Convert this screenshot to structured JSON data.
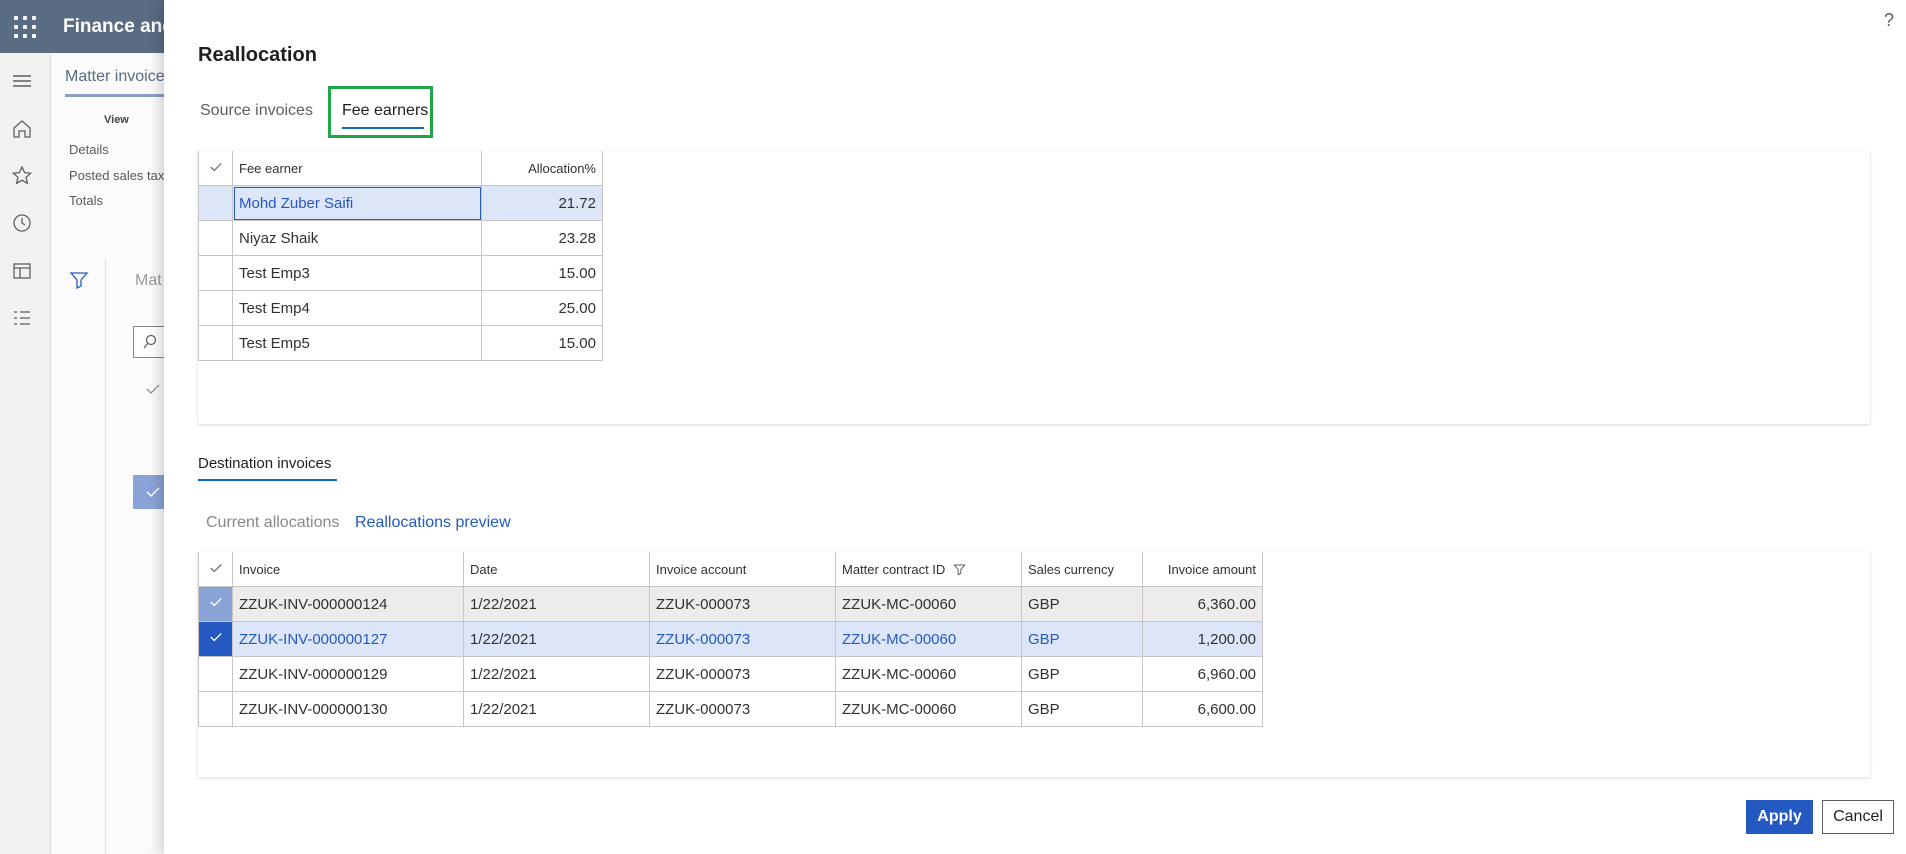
{
  "app": {
    "title": "Finance and",
    "page_tab": "Matter invoice",
    "view_label": "View",
    "menu": [
      "Details",
      "Posted sales tax",
      "Totals"
    ],
    "list_title": "Mat"
  },
  "dialog": {
    "title": "Reallocation",
    "help": "?",
    "tabs": {
      "source": "Source invoices",
      "fee_earners": "Fee earners"
    },
    "fee_grid": {
      "headers": {
        "fee_earner": "Fee earner",
        "allocation": "Allocation%"
      },
      "rows": [
        {
          "name": "Mohd Zuber Saifi",
          "allocation": "21.72"
        },
        {
          "name": "Niyaz Shaik",
          "allocation": "23.28"
        },
        {
          "name": "Test Emp3",
          "allocation": "15.00"
        },
        {
          "name": "Test Emp4",
          "allocation": "25.00"
        },
        {
          "name": "Test Emp5",
          "allocation": "15.00"
        }
      ]
    },
    "destination": {
      "title": "Destination invoices",
      "subtabs": {
        "current": "Current allocations",
        "preview": "Reallocations preview"
      },
      "headers": {
        "invoice": "Invoice",
        "date": "Date",
        "invoice_account": "Invoice account",
        "matter_contract": "Matter contract ID",
        "sales_currency": "Sales currency",
        "invoice_amount": "Invoice amount"
      },
      "rows": [
        {
          "invoice": "ZZUK-INV-000000124",
          "date": "1/22/2021",
          "account": "ZZUK-000073",
          "contract": "ZZUK-MC-00060",
          "currency": "GBP",
          "amount": "6,360.00"
        },
        {
          "invoice": "ZZUK-INV-000000127",
          "date": "1/22/2021",
          "account": "ZZUK-000073",
          "contract": "ZZUK-MC-00060",
          "currency": "GBP",
          "amount": "1,200.00"
        },
        {
          "invoice": "ZZUK-INV-000000129",
          "date": "1/22/2021",
          "account": "ZZUK-000073",
          "contract": "ZZUK-MC-00060",
          "currency": "GBP",
          "amount": "6,960.00"
        },
        {
          "invoice": "ZZUK-INV-000000130",
          "date": "1/22/2021",
          "account": "ZZUK-000073",
          "contract": "ZZUK-MC-00060",
          "currency": "GBP",
          "amount": "6,600.00"
        }
      ]
    },
    "buttons": {
      "apply": "Apply",
      "cancel": "Cancel"
    }
  },
  "colors": {
    "accent": "#2559c2",
    "highlight_box": "#1fa646",
    "selected_row": "#dde6f8",
    "topbar": "#5a6b84"
  }
}
